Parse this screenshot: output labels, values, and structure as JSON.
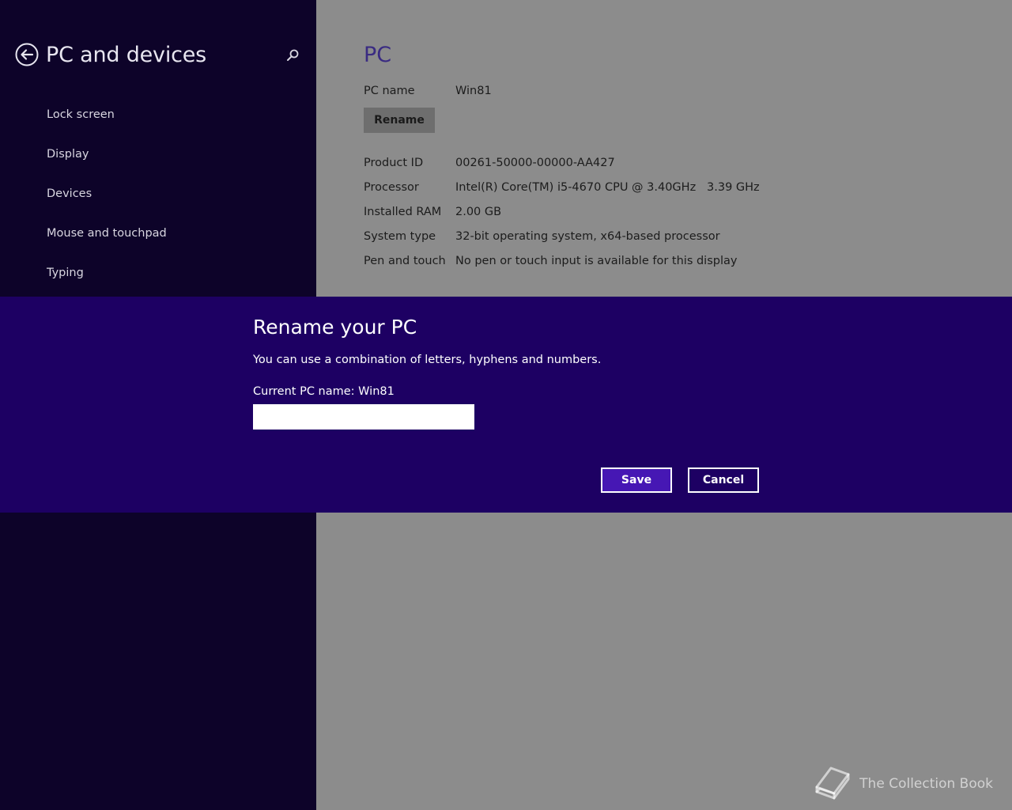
{
  "sidebar": {
    "title": "PC and devices",
    "back_icon": "back-arrow-circle-icon",
    "search_icon": "search-icon",
    "items": [
      {
        "label": "Lock screen"
      },
      {
        "label": "Display"
      },
      {
        "label": "Devices"
      },
      {
        "label": "Mouse and touchpad"
      },
      {
        "label": "Typing"
      }
    ]
  },
  "main": {
    "title": "PC",
    "pc_name_label": "PC name",
    "pc_name_value": "Win81",
    "rename_label": "Rename",
    "details": [
      {
        "label": "Product ID",
        "value": "00261-50000-00000-AA427"
      },
      {
        "label": "Processor",
        "value": "Intel(R) Core(TM) i5-4670 CPU @ 3.40GHz   3.39 GHz"
      },
      {
        "label": "Installed RAM",
        "value": "2.00 GB"
      },
      {
        "label": "System type",
        "value": "32-bit operating system, x64-based processor"
      },
      {
        "label": "Pen and touch",
        "value": "No pen or touch input is available for this display"
      }
    ]
  },
  "dialog": {
    "title": "Rename your PC",
    "description": "You can use a combination of letters, hyphens and numbers.",
    "current_name": "Current PC name: Win81",
    "input_value": "",
    "input_placeholder": "",
    "save_label": "Save",
    "cancel_label": "Cancel"
  },
  "watermark": {
    "text": "The Collection Book",
    "icon": "book-icon"
  },
  "colors": {
    "sidebar_bg": "#0d0329",
    "content_bg": "#8c8c8c",
    "dialog_bg": "#1d0063",
    "accent": "#4617b4",
    "title_text": "#3a2b82"
  }
}
